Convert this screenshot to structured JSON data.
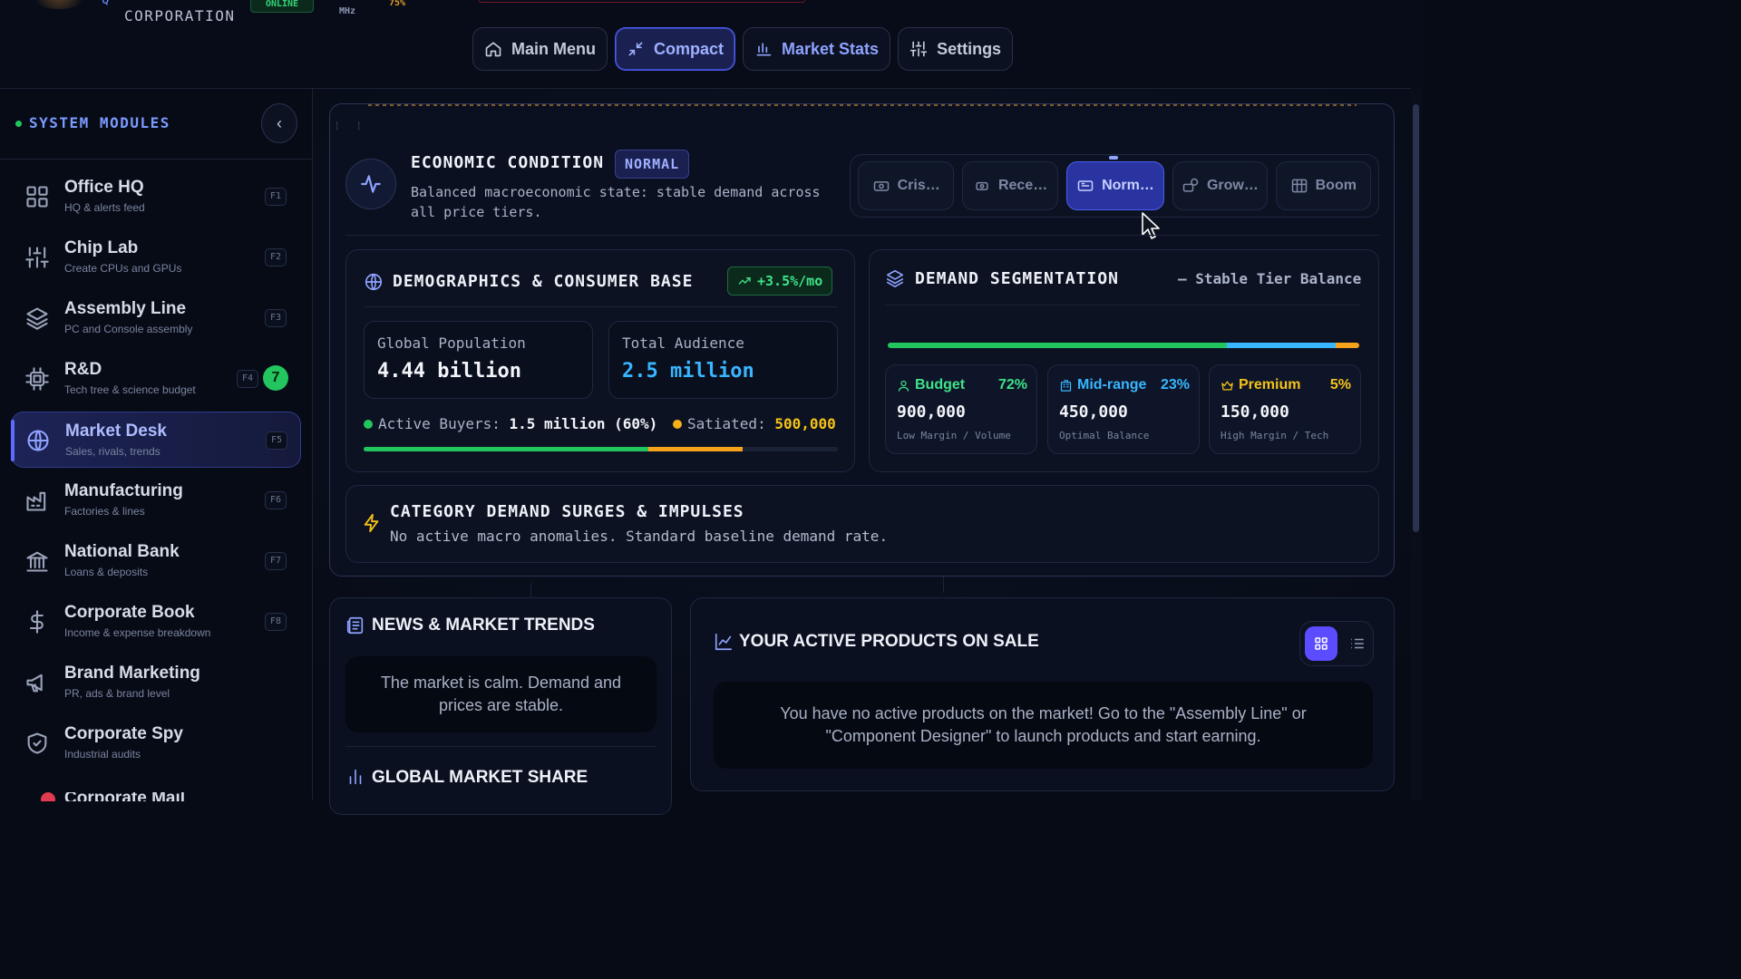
{
  "header": {
    "brand_line2": "CORPORATION",
    "brand_partial": "Q",
    "status_online": "ONLINE",
    "status_mhz": "MHz",
    "status_pct": "75%"
  },
  "topnav": {
    "items": [
      {
        "label": "Main Menu",
        "icon": "home-icon"
      },
      {
        "label": "Compact",
        "icon": "compact-icon",
        "active": true
      },
      {
        "label": "Market Stats",
        "icon": "bar-chart-icon"
      },
      {
        "label": "Settings",
        "icon": "sliders-icon"
      }
    ]
  },
  "sidebar": {
    "title": "SYSTEM MODULES",
    "collapse_glyph": "‹",
    "items": [
      {
        "label": "Office HQ",
        "sub": "HQ & alerts feed",
        "key": "F1",
        "icon": "grid-icon"
      },
      {
        "label": "Chip Lab",
        "sub": "Create CPUs and GPUs",
        "key": "F2",
        "icon": "sliders-icon"
      },
      {
        "label": "Assembly Line",
        "sub": "PC and Console assembly",
        "key": "F3",
        "icon": "layers-icon"
      },
      {
        "label": "R&D",
        "sub": "Tech tree & science budget",
        "key": "F4",
        "icon": "cpu-icon",
        "badge": "7"
      },
      {
        "label": "Market Desk",
        "sub": "Sales, rivals, trends",
        "key": "F5",
        "icon": "globe-icon",
        "active": true
      },
      {
        "label": "Manufacturing",
        "sub": "Factories & lines",
        "key": "F6",
        "icon": "factory-icon"
      },
      {
        "label": "National Bank",
        "sub": "Loans & deposits",
        "key": "F7",
        "icon": "bank-icon"
      },
      {
        "label": "Corporate Book",
        "sub": "Income & expense breakdown",
        "key": "F8",
        "icon": "dollar-icon"
      },
      {
        "label": "Brand Marketing",
        "sub": "PR, ads & brand level",
        "key": "",
        "icon": "megaphone-icon"
      },
      {
        "label": "Corporate Spy",
        "sub": "Industrial audits",
        "key": "",
        "icon": "shield-icon"
      }
    ],
    "peek_label": "Corporate Mail"
  },
  "economy": {
    "title": "ECONOMIC CONDITION",
    "badge": "NORMAL",
    "description": "Balanced macroeconomic state: stable demand across all price tiers.",
    "states": [
      {
        "label": "Cris…",
        "icon": "crisis-icon"
      },
      {
        "label": "Rece…",
        "icon": "recession-icon"
      },
      {
        "label": "Norm…",
        "icon": "normal-icon",
        "active": true
      },
      {
        "label": "Grow…",
        "icon": "growth-icon"
      },
      {
        "label": "Boom",
        "icon": "boom-icon"
      }
    ]
  },
  "demographics": {
    "title": "DEMOGRAPHICS & CONSUMER BASE",
    "growth": "+3.5%/mo",
    "population_label": "Global Population",
    "population_value": "4.44 billion",
    "audience_label": "Total Audience",
    "audience_value": "2.5 million",
    "active_label": "Active Buyers:",
    "active_value": "1.5 million (60%)",
    "satiated_label": "Satiated:",
    "satiated_value": "500,000",
    "active_fraction": 0.6,
    "satiated_fraction": 0.2,
    "colors": {
      "active": "#22c55e",
      "satiated": "#f5a31a"
    }
  },
  "segmentation": {
    "title": "DEMAND SEGMENTATION",
    "balance": "— Stable Tier Balance",
    "tiers": [
      {
        "name": "Budget",
        "pct": "72%",
        "fraction": 0.72,
        "count": "900,000",
        "note": "Low Margin / Volume",
        "color": "#22c55e",
        "icon": "user-icon"
      },
      {
        "name": "Mid-range",
        "pct": "23%",
        "fraction": 0.23,
        "count": "450,000",
        "note": "Optimal Balance",
        "color": "#38b6ff",
        "icon": "building-icon"
      },
      {
        "name": "Premium",
        "pct": "5%",
        "fraction": 0.05,
        "count": "150,000",
        "note": "High Margin / Tech",
        "color": "#f5a31a",
        "icon": "crown-icon"
      }
    ]
  },
  "surges": {
    "title": "CATEGORY DEMAND SURGES & IMPULSES",
    "text": "No active macro anomalies. Standard baseline demand rate."
  },
  "news": {
    "title": "NEWS & MARKET TRENDS",
    "message": "The market is calm. Demand and prices are stable.",
    "share_title": "GLOBAL MARKET SHARE"
  },
  "products": {
    "title": "YOUR ACTIVE PRODUCTS ON SALE",
    "empty_message": "You have no active products on the market! Go to the \"Assembly Line\" or \"Component Designer\" to launch products and start earning."
  }
}
